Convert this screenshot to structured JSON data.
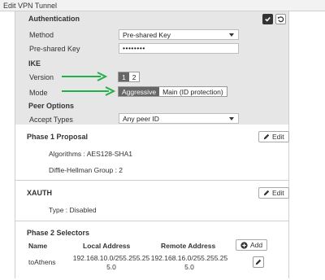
{
  "window": {
    "title": "Edit VPN Tunnel"
  },
  "authentication": {
    "heading": "Authentication",
    "method_label": "Method",
    "method_value": "Pre-shared Key",
    "psk_label": "Pre-shared Key",
    "psk_value": "••••••••"
  },
  "ike": {
    "heading": "IKE",
    "version_label": "Version",
    "version_options": [
      "1",
      "2"
    ],
    "mode_label": "Mode",
    "mode_options": [
      "Aggressive",
      "Main (ID protection)"
    ]
  },
  "peer_options": {
    "heading": "Peer Options",
    "accept_types_label": "Accept Types",
    "accept_types_value": "Any peer ID"
  },
  "phase1": {
    "heading": "Phase 1 Proposal",
    "edit_label": "Edit",
    "algorithms": "Algorithms : AES128-SHA1",
    "dh_group": "Diffie-Hellman Group : 2"
  },
  "xauth": {
    "heading": "XAUTH",
    "edit_label": "Edit",
    "type": "Type : Disabled"
  },
  "phase2": {
    "heading": "Phase 2 Selectors",
    "add_label": "Add",
    "columns": [
      "Name",
      "Local Address",
      "Remote Address"
    ],
    "rows": [
      {
        "name": "toAthens",
        "local_line1": "192.168.10.0/255.255.25",
        "local_line2": "5.0",
        "remote_line1": "192.168.16.0/255.255.25",
        "remote_line2": "5.0"
      }
    ]
  },
  "colors": {
    "annotation_arrow": "#22b04a",
    "segment_active": "#666666"
  }
}
